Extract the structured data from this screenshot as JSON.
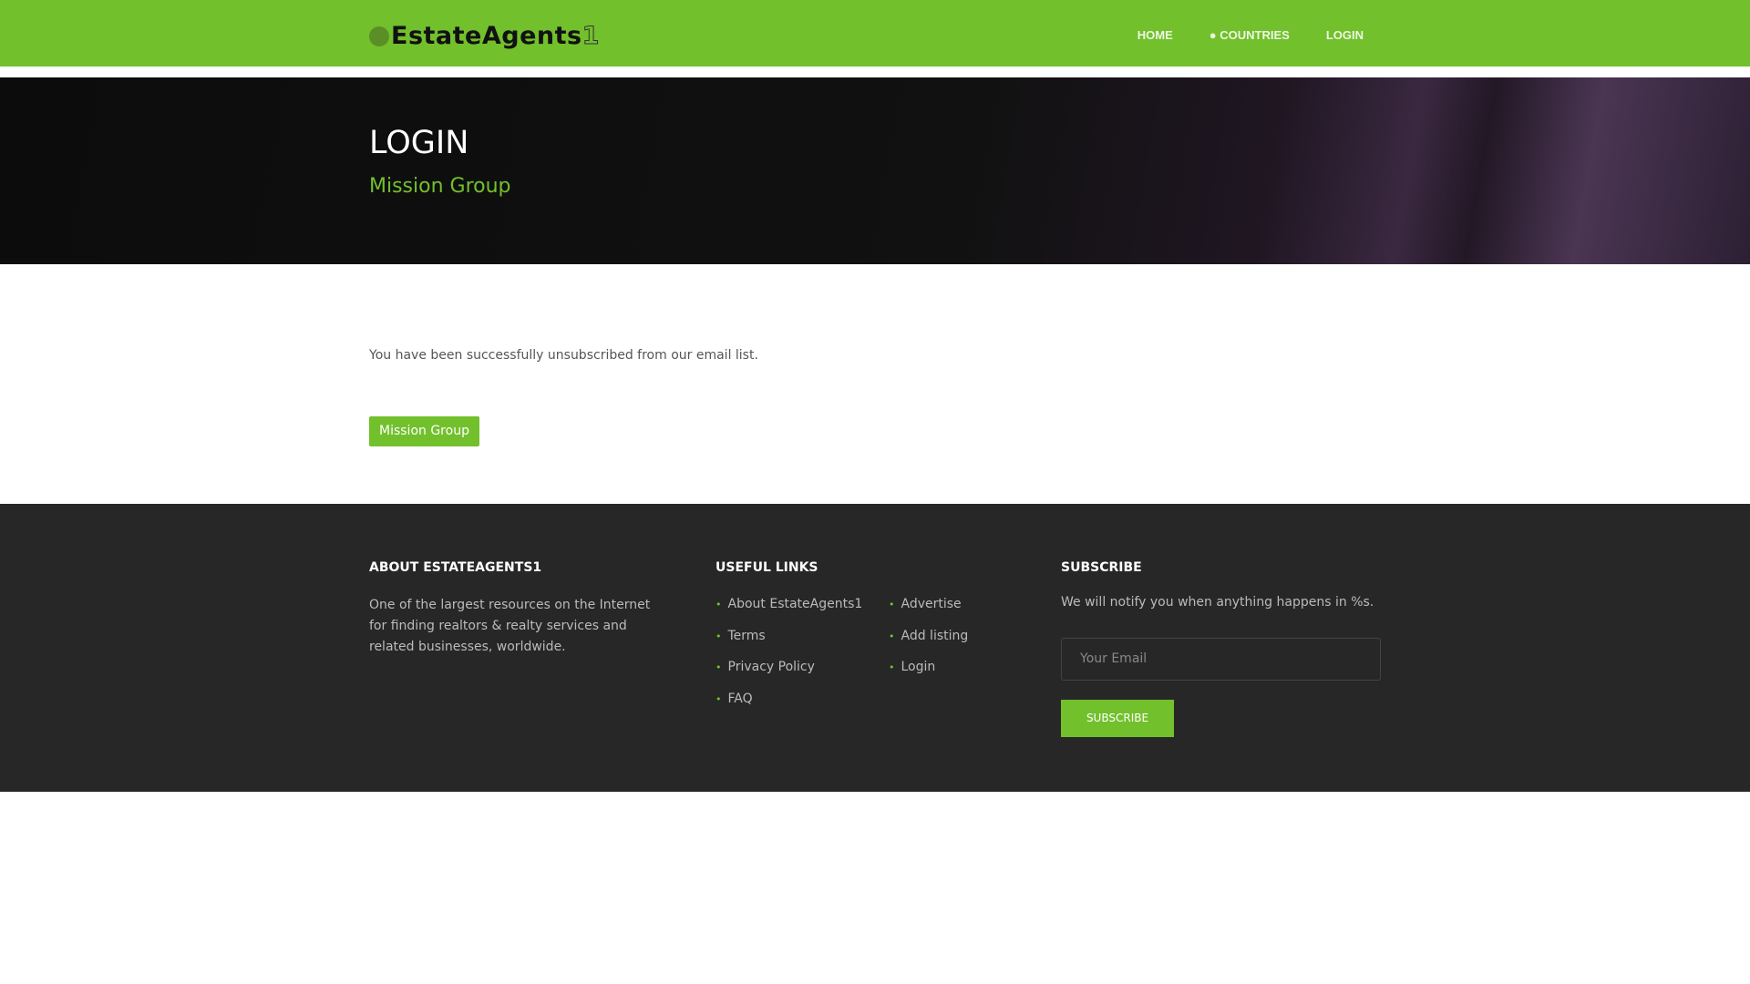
{
  "header": {
    "logo_text": "EstateAgents",
    "logo_suffix": "1",
    "nav": [
      "HOME",
      "COUNTRIES",
      "LOGIN"
    ]
  },
  "hero": {
    "title": "LOGIN",
    "subtitle": "Mission Group"
  },
  "main": {
    "message": "You have been successfully unsubscribed from our email list.",
    "button": "Mission Group"
  },
  "footer": {
    "about": {
      "heading": "ABOUT ESTATEAGENTS1",
      "text": "One of the largest resources on the Internet for finding realtors & realty services and related businesses, worldwide."
    },
    "links": {
      "heading": "USEFUL LINKS",
      "col1": [
        "About EstateAgents1",
        "Terms",
        "Privacy Policy",
        "FAQ"
      ],
      "col2": [
        "Advertise",
        "Add listing",
        "Login"
      ]
    },
    "subscribe": {
      "heading": "SUBSCRIBE",
      "text": "We will notify you when anything happens in %s.",
      "placeholder": "Your Email",
      "button": "SUBSCRIBE"
    }
  }
}
